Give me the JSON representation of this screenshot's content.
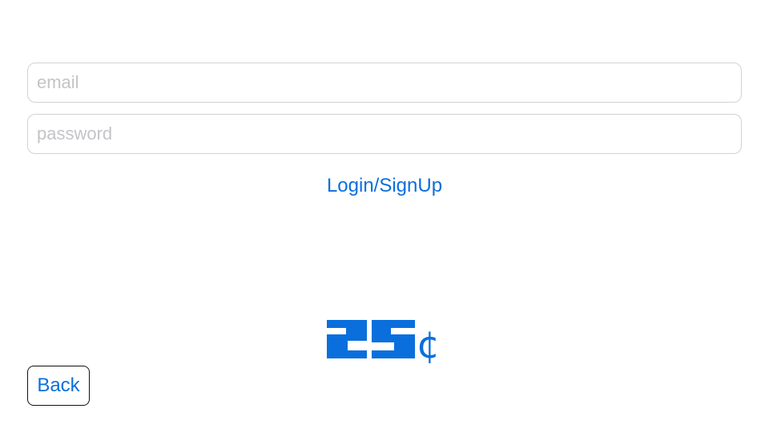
{
  "form": {
    "email": {
      "value": "",
      "placeholder": "email"
    },
    "password": {
      "value": "",
      "placeholder": "password"
    },
    "login_label": "Login/SignUp"
  },
  "logo": {
    "text": "25¢",
    "color": "#0a6fdc"
  },
  "nav": {
    "back_label": "Back"
  },
  "colors": {
    "accent": "#0a6fdc",
    "field_border": "#d2d2d4",
    "placeholder": "#c4c4c8",
    "back_border": "#111111"
  }
}
